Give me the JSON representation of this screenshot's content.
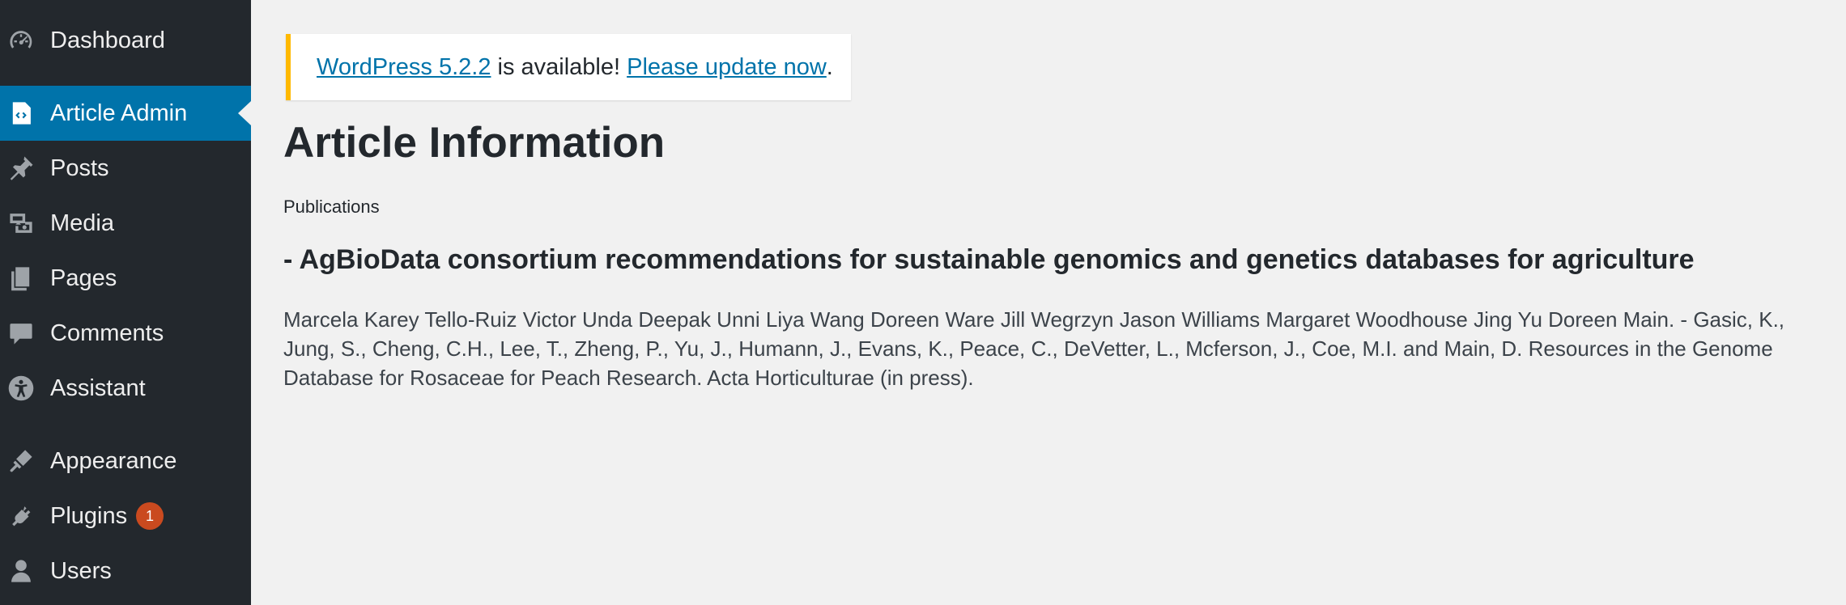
{
  "sidebar": {
    "items": [
      {
        "label": "Dashboard",
        "icon": "dashboard-icon"
      },
      {
        "label": "Article Admin",
        "icon": "code-icon",
        "active": true
      },
      {
        "label": "Posts",
        "icon": "pin-icon"
      },
      {
        "label": "Media",
        "icon": "media-icon"
      },
      {
        "label": "Pages",
        "icon": "pages-icon"
      },
      {
        "label": "Comments",
        "icon": "comment-icon"
      },
      {
        "label": "Assistant",
        "icon": "accessibility-icon"
      },
      {
        "label": "Appearance",
        "icon": "brush-icon"
      },
      {
        "label": "Plugins",
        "icon": "plugin-icon",
        "badge": "1"
      },
      {
        "label": "Users",
        "icon": "user-icon"
      }
    ]
  },
  "notice": {
    "version_link": "WordPress 5.2.2",
    "middle_text": " is available! ",
    "update_link": "Please update now",
    "end_text": "."
  },
  "main": {
    "page_title": "Article Information",
    "section_label": "Publications",
    "article_title": "- AgBioData consortium recommendations for sustainable genomics and genetics databases for agriculture",
    "article_body": "Marcela Karey Tello-Ruiz Victor Unda Deepak Unni Liya Wang Doreen Ware Jill Wegrzyn Jason Williams Margaret Woodhouse Jing Yu Doreen Main. - Gasic, K., Jung, S., Cheng, C.H., Lee, T., Zheng, P., Yu, J., Humann, J., Evans, K., Peace, C., DeVetter, L., Mcferson, J., Coe, M.I. and Main, D. Resources in the Genome Database for Rosaceae for Peach Research. Acta Horticulturae (in press)."
  },
  "colors": {
    "sidebar_bg": "#23282d",
    "active_bg": "#0073aa",
    "notice_border": "#ffb900",
    "badge_bg": "#ca4a1f",
    "link": "#0073aa"
  }
}
